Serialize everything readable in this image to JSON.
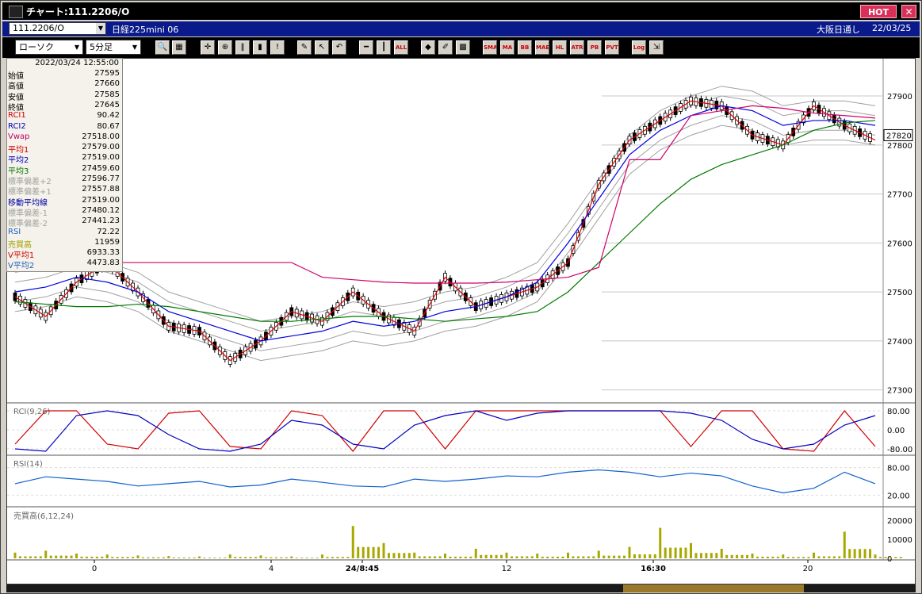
{
  "window": {
    "title": "チャート:111.2206/O",
    "hot_label": "HOT",
    "close_label": "✕"
  },
  "infobar": {
    "symbol": "111.2206/O",
    "name": "日経225mini 06",
    "session": "大阪日通し",
    "date": "22/03/25"
  },
  "toolbar": {
    "chart_type": "ローソク",
    "interval": "5分足",
    "icons": [
      "search-icon",
      "grid-icon",
      "crosshair-icon",
      "zoom-icon",
      "bars-icon",
      "candle-icon",
      "info-icon",
      "pen-icon",
      "cursor-icon",
      "undo-icon",
      "hline-icon",
      "vline-icon",
      "all-icon",
      "cube-icon",
      "brush-icon",
      "palette-icon",
      "sma-icon",
      "ma-icon",
      "bb-icon",
      "mae-icon",
      "hl-icon",
      "atr-icon",
      "pb-icon",
      "pvt-icon",
      "log-icon",
      "export-icon"
    ],
    "text_buttons": {
      "all": "ALL",
      "sma": "SMA",
      "ma": "MA",
      "bb": "BB",
      "mae": "MAE",
      "hl": "HL",
      "atr": "ATR",
      "pb": "PB",
      "pvt": "PVT",
      "log": "Log"
    }
  },
  "data_panel": {
    "datetime": "2022/03/24 12:55:00",
    "rows": [
      {
        "label": "始値",
        "value": "27595",
        "color": "#000000"
      },
      {
        "label": "高値",
        "value": "27660",
        "color": "#000000"
      },
      {
        "label": "安値",
        "value": "27585",
        "color": "#000000"
      },
      {
        "label": "終値",
        "value": "27645",
        "color": "#000000"
      },
      {
        "label": "RCI1",
        "value": "90.42",
        "color": "#d00000"
      },
      {
        "label": "RCI2",
        "value": "80.67",
        "color": "#0000c0"
      },
      {
        "label": "Vwap",
        "value": "27518.00",
        "color": "#c0006a"
      },
      {
        "label": "平均1",
        "value": "27579.00",
        "color": "#d00000"
      },
      {
        "label": "平均2",
        "value": "27519.00",
        "color": "#0000c0"
      },
      {
        "label": "平均3",
        "value": "27459.60",
        "color": "#007000"
      },
      {
        "label": "標準偏差+2",
        "value": "27596.77",
        "color": "#a0a0a0"
      },
      {
        "label": "標準偏差+1",
        "value": "27557.88",
        "color": "#a0a0a0"
      },
      {
        "label": "移動平均線",
        "value": "27519.00",
        "color": "#0000a0"
      },
      {
        "label": "標準偏差-1",
        "value": "27480.12",
        "color": "#a0a0a0"
      },
      {
        "label": "標準偏差-2",
        "value": "27441.23",
        "color": "#a0a0a0"
      },
      {
        "label": "RSI",
        "value": "72.22",
        "color": "#2060c0"
      },
      {
        "label": "売買高",
        "value": "11959",
        "color": "#a0a000"
      },
      {
        "label": "V平均1",
        "value": "6933.33",
        "color": "#d00000"
      },
      {
        "label": "V平均2",
        "value": "4473.83",
        "color": "#2060c0"
      }
    ]
  },
  "chart": {
    "price_axis": [
      "27900",
      "27800",
      "27700",
      "27600",
      "27500",
      "27400",
      "27300"
    ],
    "last_price": "27820",
    "time_axis": [
      "0",
      "4",
      "24/8:45",
      "12",
      "16:30",
      "20"
    ],
    "rci_label": "RCI(9,26)",
    "rci_axis": [
      "80.00",
      "0.00",
      "-80.00"
    ],
    "rsi_label": "RSI(14)",
    "rsi_axis": [
      "80.00",
      "20.00"
    ],
    "vol_label": "売買高(6,12,24)",
    "vol_axis": [
      "20000",
      "10000",
      "0"
    ],
    "colors": {
      "ma1": "#e00000",
      "ma2": "#0000e0",
      "ma3": "#007a00",
      "vwap": "#d0006a",
      "band": "#a0a0a0",
      "vol": "#a8a800",
      "rsi": "#1060d0"
    }
  },
  "chart_data": [
    {
      "type": "line",
      "title": "",
      "ylim": [
        27280,
        27960
      ],
      "series": [
        {
          "name": "平均1",
          "values": [
            27490,
            27450,
            27520,
            27560,
            27500,
            27430,
            27420,
            27360,
            27400,
            27460,
            27440,
            27500,
            27450,
            27420,
            27530,
            27470,
            27490,
            27510,
            27560,
            27720,
            27810,
            27850,
            27890,
            27880,
            27820,
            27800,
            27880,
            27840,
            27810
          ]
        },
        {
          "name": "平均2",
          "values": [
            27500,
            27510,
            27530,
            27520,
            27500,
            27460,
            27440,
            27420,
            27400,
            27410,
            27420,
            27440,
            27430,
            27440,
            27460,
            27470,
            27490,
            27520,
            27600,
            27690,
            27780,
            27830,
            27860,
            27880,
            27870,
            27840,
            27850,
            27850,
            27840
          ]
        },
        {
          "name": "平均3",
          "values": [
            27480,
            27475,
            27470,
            27470,
            27475,
            27470,
            27460,
            27450,
            27440,
            27440,
            27445,
            27450,
            27450,
            27445,
            27440,
            27445,
            27450,
            27460,
            27500,
            27560,
            27620,
            27680,
            27730,
            27760,
            27780,
            27800,
            27830,
            27845,
            27850
          ]
        },
        {
          "name": "Vwap",
          "values": [
            27560,
            27560,
            27560,
            27560,
            27560,
            27560,
            27560,
            27560,
            27560,
            27560,
            27530,
            27525,
            27520,
            27518,
            27518,
            27518,
            27520,
            27525,
            27530,
            27550,
            27770,
            27770,
            27860,
            27870,
            27880,
            27875,
            27865,
            27860,
            27855
          ]
        }
      ]
    },
    {
      "type": "line",
      "title": "RCI(9,26)",
      "ylim": [
        -100,
        100
      ],
      "series": [
        {
          "name": "RCI1",
          "values": [
            -60,
            80,
            80,
            -60,
            -80,
            70,
            80,
            -70,
            -80,
            80,
            60,
            -90,
            80,
            80,
            -80,
            80,
            80,
            80,
            80,
            80,
            80,
            80,
            -70,
            80,
            80,
            -80,
            -90,
            80,
            -70
          ]
        },
        {
          "name": "RCI2",
          "values": [
            -80,
            -90,
            60,
            80,
            60,
            -20,
            -80,
            -90,
            -60,
            40,
            20,
            -60,
            -80,
            20,
            60,
            80,
            40,
            70,
            80,
            80,
            80,
            80,
            70,
            40,
            -40,
            -80,
            -60,
            20,
            60
          ]
        }
      ]
    },
    {
      "type": "line",
      "title": "RSI(14)",
      "ylim": [
        0,
        100
      ],
      "series": [
        {
          "name": "RSI",
          "values": [
            45,
            60,
            55,
            50,
            40,
            45,
            50,
            38,
            42,
            55,
            48,
            40,
            38,
            55,
            50,
            55,
            62,
            60,
            70,
            75,
            70,
            60,
            68,
            62,
            40,
            25,
            35,
            70,
            45
          ]
        }
      ]
    },
    {
      "type": "bar",
      "title": "売買高(6,12,24)",
      "ylim": [
        0,
        25000
      ],
      "values": [
        3000,
        4000,
        2500,
        2000,
        1500,
        1200,
        1000,
        2000,
        1500,
        1000,
        2000,
        17000,
        8000,
        3000,
        2500,
        5000,
        3000,
        2500,
        3000,
        4000,
        6000,
        16000,
        8000,
        5000,
        2500,
        2000,
        3000,
        14000,
        2000
      ]
    }
  ]
}
